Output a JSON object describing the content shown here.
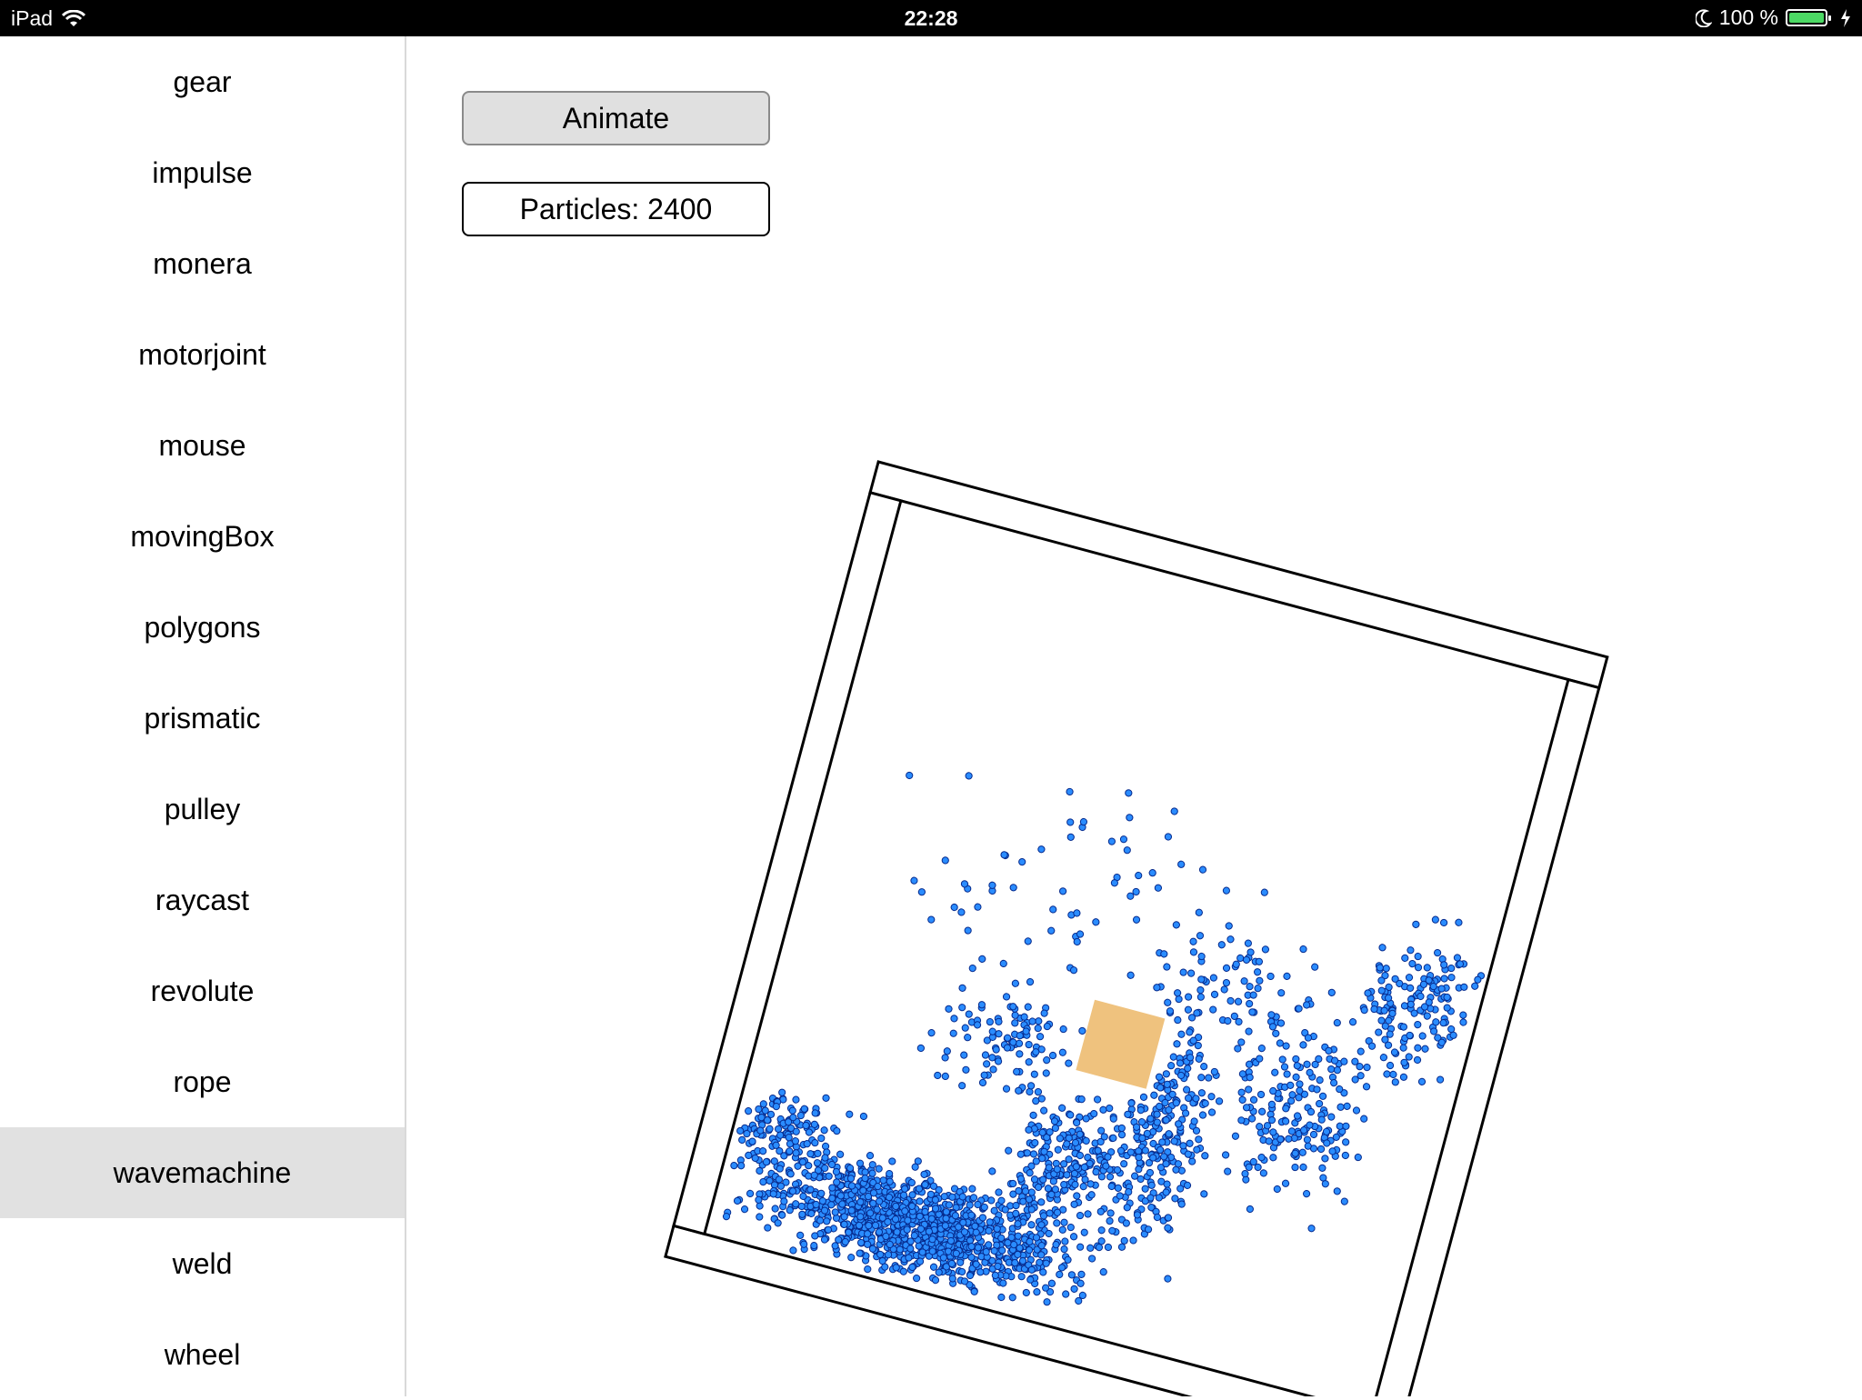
{
  "status_bar": {
    "device": "iPad",
    "time": "22:28",
    "battery": "100 %",
    "icons": [
      "wifi-icon",
      "moon-icon",
      "battery-icon",
      "charging-bolt-icon"
    ]
  },
  "sidebar": {
    "items": [
      {
        "label": "gear"
      },
      {
        "label": "impulse"
      },
      {
        "label": "monera"
      },
      {
        "label": "motorjoint"
      },
      {
        "label": "mouse"
      },
      {
        "label": "movingBox"
      },
      {
        "label": "polygons"
      },
      {
        "label": "prismatic"
      },
      {
        "label": "pulley"
      },
      {
        "label": "raycast"
      },
      {
        "label": "revolute"
      },
      {
        "label": "rope"
      },
      {
        "label": "wavemachine",
        "selected": true
      },
      {
        "label": "weld"
      },
      {
        "label": "wheel"
      }
    ],
    "selected_color": "#e1e1e1"
  },
  "controls": {
    "animate_label": "Animate",
    "particles_label": "Particles: 2400"
  },
  "simulation": {
    "particle_count": 2400,
    "particle_color": "#2a8cff",
    "particle_stroke": "#062a8c",
    "box_color": "#efc27e",
    "container_tilt_degrees": 15
  }
}
